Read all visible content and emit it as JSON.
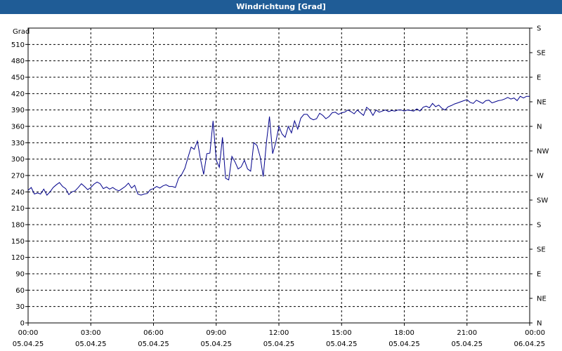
{
  "window": {
    "title": "Windrichtung [Grad]"
  },
  "chart_data": {
    "type": "line",
    "title": "Windrichtung [Grad]",
    "ylabel": "Grad",
    "ylim": [
      0,
      540
    ],
    "yticks": [
      0,
      30,
      60,
      90,
      120,
      150,
      180,
      210,
      240,
      270,
      300,
      330,
      360,
      390,
      420,
      450,
      480,
      510
    ],
    "y2_labels": [
      "N",
      "NE",
      "E",
      "SE",
      "S",
      "SW",
      "W",
      "NW",
      "N",
      "NE",
      "E",
      "SE",
      "S"
    ],
    "xlim_hours": [
      0,
      24
    ],
    "x_ticks": [
      {
        "time": "00:00",
        "date": "05.04.25"
      },
      {
        "time": "03:00",
        "date": "05.04.25"
      },
      {
        "time": "06:00",
        "date": "05.04.25"
      },
      {
        "time": "09:00",
        "date": "05.04.25"
      },
      {
        "time": "12:00",
        "date": "05.04.25"
      },
      {
        "time": "15:00",
        "date": "05.04.25"
      },
      {
        "time": "18:00",
        "date": "05.04.25"
      },
      {
        "time": "21:00",
        "date": "05.04.25"
      },
      {
        "time": "00:00",
        "date": "06.04.25"
      }
    ],
    "grid": true,
    "series": [
      {
        "color": "#00008b",
        "points": [
          [
            0.0,
            243
          ],
          [
            0.15,
            248
          ],
          [
            0.3,
            236
          ],
          [
            0.45,
            238
          ],
          [
            0.6,
            236
          ],
          [
            0.75,
            245
          ],
          [
            0.9,
            234
          ],
          [
            1.05,
            240
          ],
          [
            1.2,
            248
          ],
          [
            1.35,
            253
          ],
          [
            1.5,
            257
          ],
          [
            1.65,
            250
          ],
          [
            1.8,
            246
          ],
          [
            1.95,
            235
          ],
          [
            2.1,
            240
          ],
          [
            2.25,
            242
          ],
          [
            2.4,
            248
          ],
          [
            2.55,
            255
          ],
          [
            2.7,
            250
          ],
          [
            2.85,
            244
          ],
          [
            3.0,
            248
          ],
          [
            3.15,
            254
          ],
          [
            3.3,
            258
          ],
          [
            3.45,
            255
          ],
          [
            3.6,
            246
          ],
          [
            3.75,
            249
          ],
          [
            3.9,
            245
          ],
          [
            4.05,
            248
          ],
          [
            4.2,
            244
          ],
          [
            4.35,
            242
          ],
          [
            4.5,
            246
          ],
          [
            4.65,
            250
          ],
          [
            4.8,
            256
          ],
          [
            4.95,
            247
          ],
          [
            5.1,
            252
          ],
          [
            5.25,
            236
          ],
          [
            5.4,
            234
          ],
          [
            5.55,
            236
          ],
          [
            5.7,
            237
          ],
          [
            5.85,
            244
          ],
          [
            6.0,
            246
          ],
          [
            6.15,
            250
          ],
          [
            6.3,
            247
          ],
          [
            6.45,
            251
          ],
          [
            6.6,
            253
          ],
          [
            6.75,
            250
          ],
          [
            6.9,
            250
          ],
          [
            7.05,
            248
          ],
          [
            7.2,
            265
          ],
          [
            7.35,
            272
          ],
          [
            7.5,
            283
          ],
          [
            7.65,
            303
          ],
          [
            7.8,
            322
          ],
          [
            7.95,
            318
          ],
          [
            8.1,
            333
          ],
          [
            8.25,
            300
          ],
          [
            8.4,
            272
          ],
          [
            8.55,
            310
          ],
          [
            8.7,
            311
          ],
          [
            8.85,
            370
          ],
          [
            9.0,
            298
          ],
          [
            9.15,
            285
          ],
          [
            9.3,
            340
          ],
          [
            9.45,
            265
          ],
          [
            9.6,
            262
          ],
          [
            9.75,
            305
          ],
          [
            9.9,
            295
          ],
          [
            10.05,
            282
          ],
          [
            10.2,
            286
          ],
          [
            10.35,
            298
          ],
          [
            10.5,
            282
          ],
          [
            10.65,
            278
          ],
          [
            10.8,
            330
          ],
          [
            10.95,
            325
          ],
          [
            11.1,
            305
          ],
          [
            11.25,
            268
          ],
          [
            11.4,
            330
          ],
          [
            11.55,
            378
          ],
          [
            11.7,
            310
          ],
          [
            11.85,
            330
          ],
          [
            12.0,
            360
          ],
          [
            12.15,
            346
          ],
          [
            12.3,
            340
          ],
          [
            12.45,
            360
          ],
          [
            12.6,
            348
          ],
          [
            12.75,
            370
          ],
          [
            12.9,
            355
          ],
          [
            13.05,
            375
          ],
          [
            13.2,
            382
          ],
          [
            13.35,
            382
          ],
          [
            13.5,
            375
          ],
          [
            13.65,
            372
          ],
          [
            13.8,
            374
          ],
          [
            13.95,
            384
          ],
          [
            14.1,
            380
          ],
          [
            14.25,
            374
          ],
          [
            14.4,
            378
          ],
          [
            14.55,
            385
          ],
          [
            14.7,
            386
          ],
          [
            14.85,
            382
          ],
          [
            15.0,
            385
          ],
          [
            15.15,
            386
          ],
          [
            15.3,
            390
          ],
          [
            15.45,
            387
          ],
          [
            15.6,
            383
          ],
          [
            15.75,
            390
          ],
          [
            15.9,
            385
          ],
          [
            16.05,
            380
          ],
          [
            16.2,
            395
          ],
          [
            16.35,
            390
          ],
          [
            16.5,
            380
          ],
          [
            16.65,
            390
          ],
          [
            16.8,
            386
          ],
          [
            16.95,
            388
          ],
          [
            17.1,
            390
          ],
          [
            17.25,
            387
          ],
          [
            17.4,
            389
          ],
          [
            17.55,
            388
          ],
          [
            17.7,
            390
          ],
          [
            17.85,
            390
          ],
          [
            18.0,
            388
          ],
          [
            18.15,
            390
          ],
          [
            18.3,
            389
          ],
          [
            18.45,
            388
          ],
          [
            18.6,
            392
          ],
          [
            18.75,
            388
          ],
          [
            18.9,
            395
          ],
          [
            19.05,
            397
          ],
          [
            19.2,
            394
          ],
          [
            19.35,
            402
          ],
          [
            19.5,
            396
          ],
          [
            19.65,
            399
          ],
          [
            19.8,
            393
          ],
          [
            19.95,
            390
          ],
          [
            20.1,
            396
          ],
          [
            20.25,
            398
          ],
          [
            20.4,
            401
          ],
          [
            20.55,
            403
          ],
          [
            20.7,
            405
          ],
          [
            20.85,
            407
          ],
          [
            21.0,
            409
          ],
          [
            21.15,
            404
          ],
          [
            21.3,
            402
          ],
          [
            21.45,
            408
          ],
          [
            21.6,
            405
          ],
          [
            21.75,
            402
          ],
          [
            21.9,
            407
          ],
          [
            22.05,
            408
          ],
          [
            22.2,
            403
          ],
          [
            22.35,
            405
          ],
          [
            22.5,
            407
          ],
          [
            22.65,
            408
          ],
          [
            22.8,
            410
          ],
          [
            22.95,
            413
          ],
          [
            23.1,
            410
          ],
          [
            23.25,
            412
          ],
          [
            23.4,
            407
          ],
          [
            23.55,
            415
          ],
          [
            23.7,
            412
          ],
          [
            23.85,
            415
          ],
          [
            24.0,
            415
          ]
        ]
      }
    ]
  }
}
